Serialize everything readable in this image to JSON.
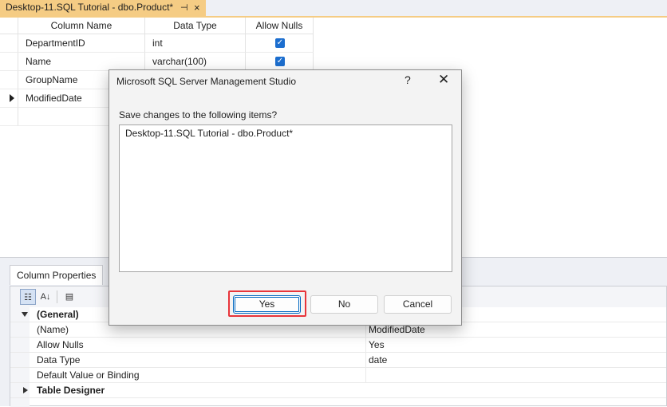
{
  "tab": {
    "title": "Desktop-11.SQL Tutorial - dbo.Product*",
    "pin_glyph": "⊣",
    "close_glyph": "×"
  },
  "grid": {
    "headers": [
      "Column Name",
      "Data Type",
      "Allow Nulls"
    ],
    "rows": [
      {
        "name": "DepartmentID",
        "type": "int",
        "allow_nulls": true,
        "current": false
      },
      {
        "name": "Name",
        "type": "varchar(100)",
        "allow_nulls": true,
        "current": false
      },
      {
        "name": "GroupName",
        "type": "",
        "allow_nulls": false,
        "current": false
      },
      {
        "name": "ModifiedDate",
        "type": "",
        "allow_nulls": false,
        "current": true
      }
    ]
  },
  "column_properties": {
    "tab_label": "Column Properties",
    "toolbar": {
      "categorized_icon": "categorized-icon",
      "alphabetical_icon": "sort-az-icon",
      "pages_icon": "property-pages-icon"
    },
    "rows": [
      {
        "name": "(General)",
        "value": "",
        "category": true,
        "expanded": true
      },
      {
        "name": "(Name)",
        "value": "ModifiedDate"
      },
      {
        "name": "Allow Nulls",
        "value": "Yes"
      },
      {
        "name": "Data Type",
        "value": "date"
      },
      {
        "name": "Default Value or Binding",
        "value": ""
      },
      {
        "name": "Table Designer",
        "value": "",
        "category": true,
        "expanded": false
      }
    ]
  },
  "dialog": {
    "title": "Microsoft SQL Server Management Studio",
    "help_glyph": "?",
    "close_glyph": "✕",
    "prompt": "Save changes to the following items?",
    "items": [
      "Desktop-11.SQL Tutorial - dbo.Product*"
    ],
    "buttons": {
      "yes": "Yes",
      "no": "No",
      "cancel": "Cancel"
    },
    "highlight_color": "#e8343a"
  },
  "colors": {
    "tab_active": "#f5cc84",
    "checkbox": "#1c6ecf",
    "accent": "#0067c0"
  }
}
